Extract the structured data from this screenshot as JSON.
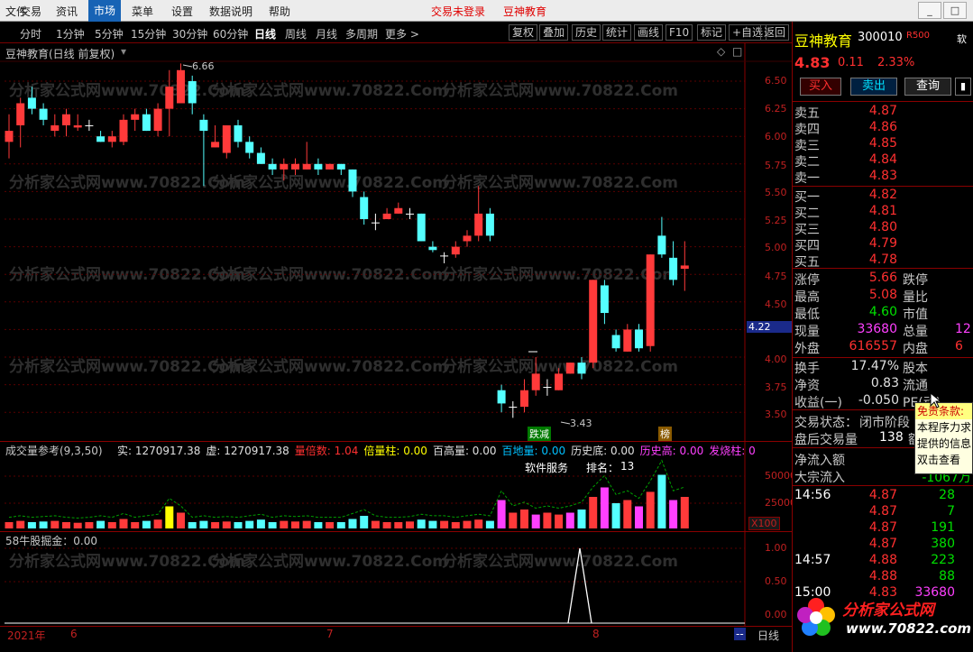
{
  "menu": {
    "items": [
      "文件",
      "交易",
      "资讯",
      "市场",
      "菜单",
      "设置",
      "数据说明",
      "帮助"
    ],
    "active": "市场",
    "login": "交易未登录",
    "brand": "豆神教育"
  },
  "toolbar": {
    "periods": [
      "分时",
      "1分钟",
      "5分钟",
      "15分钟",
      "30分钟",
      "60分钟",
      "日线",
      "周线",
      "月线",
      "多周期",
      "更多 >"
    ],
    "active": "日线",
    "buttons": [
      "复权",
      "叠加",
      "历史",
      "统计",
      "画线",
      "F10",
      "标记",
      "+自选",
      "返回"
    ]
  },
  "chart": {
    "title": "豆神教育(日线 前复权)",
    "price_labels": [
      "6.50",
      "6.25",
      "6.00",
      "5.75",
      "5.50",
      "5.25",
      "5.00",
      "4.75",
      "4.50",
      "4.22",
      "4.00",
      "3.75",
      "3.50"
    ],
    "current_price": "4.22",
    "high_marker": "6.66",
    "low_marker": "3.43",
    "tags": {
      "fall": "跌减",
      "bang": "榜"
    },
    "watermark": "分析家公式网www.70822.Com",
    "candles": [
      {
        "o": 5.95,
        "c": 6.05,
        "h": 6.2,
        "l": 5.8
      },
      {
        "o": 6.1,
        "c": 6.3,
        "h": 6.35,
        "l": 5.9
      },
      {
        "o": 6.35,
        "c": 6.25,
        "h": 6.45,
        "l": 6.2
      },
      {
        "o": 6.25,
        "c": 6.15,
        "h": 6.3,
        "l": 6.1
      },
      {
        "o": 6.05,
        "c": 6.1,
        "h": 6.2,
        "l": 6.0
      },
      {
        "o": 6.1,
        "c": 6.2,
        "h": 6.25,
        "l": 6.0
      },
      {
        "o": 6.08,
        "c": 6.1,
        "h": 6.2,
        "l": 6.05
      },
      {
        "o": 6.1,
        "c": 6.1,
        "h": 6.15,
        "l": 6.05
      },
      {
        "o": 6.0,
        "c": 5.95,
        "h": 6.05,
        "l": 5.95
      },
      {
        "o": 5.95,
        "c": 6.0,
        "h": 6.05,
        "l": 5.9
      },
      {
        "o": 5.95,
        "c": 6.15,
        "h": 6.2,
        "l": 5.92
      },
      {
        "o": 6.15,
        "c": 6.2,
        "h": 6.25,
        "l": 6.05
      },
      {
        "o": 6.2,
        "c": 6.05,
        "h": 6.25,
        "l": 6.05
      },
      {
        "o": 6.05,
        "c": 6.25,
        "h": 6.3,
        "l": 6.0
      },
      {
        "o": 6.25,
        "c": 6.45,
        "h": 6.6,
        "l": 6.0
      },
      {
        "o": 6.3,
        "c": 6.6,
        "h": 6.66,
        "l": 6.3
      },
      {
        "o": 6.5,
        "c": 6.3,
        "h": 6.55,
        "l": 6.2
      },
      {
        "o": 6.15,
        "c": 6.05,
        "h": 6.2,
        "l": 5.55
      },
      {
        "o": 5.9,
        "c": 5.95,
        "h": 6.1,
        "l": 5.9
      },
      {
        "o": 5.85,
        "c": 6.1,
        "h": 6.1,
        "l": 5.8
      },
      {
        "o": 6.1,
        "c": 5.95,
        "h": 6.15,
        "l": 5.9
      },
      {
        "o": 5.95,
        "c": 5.85,
        "h": 6.0,
        "l": 5.8
      },
      {
        "o": 5.85,
        "c": 5.75,
        "h": 5.9,
        "l": 5.75
      },
      {
        "o": 5.75,
        "c": 5.7,
        "h": 5.8,
        "l": 5.65
      },
      {
        "o": 5.7,
        "c": 5.75,
        "h": 5.8,
        "l": 5.6
      },
      {
        "o": 5.7,
        "c": 5.75,
        "h": 5.8,
        "l": 5.65
      },
      {
        "o": 5.7,
        "c": 5.75,
        "h": 5.95,
        "l": 5.7
      },
      {
        "o": 5.75,
        "c": 5.7,
        "h": 5.8,
        "l": 5.65
      },
      {
        "o": 5.7,
        "c": 5.75,
        "h": 5.75,
        "l": 5.7
      },
      {
        "o": 5.75,
        "c": 5.7,
        "h": 5.75,
        "l": 5.65
      },
      {
        "o": 5.7,
        "c": 5.5,
        "h": 5.7,
        "l": 5.45
      },
      {
        "o": 5.45,
        "c": 5.25,
        "h": 5.5,
        "l": 5.2
      },
      {
        "o": 5.22,
        "c": 5.22,
        "h": 5.3,
        "l": 5.15
      },
      {
        "o": 5.25,
        "c": 5.3,
        "h": 5.35,
        "l": 5.25
      },
      {
        "o": 5.3,
        "c": 5.35,
        "h": 5.4,
        "l": 5.3
      },
      {
        "o": 5.3,
        "c": 5.3,
        "h": 5.35,
        "l": 5.25
      },
      {
        "o": 5.3,
        "c": 5.05,
        "h": 5.3,
        "l": 5.05
      },
      {
        "o": 5.0,
        "c": 4.97,
        "h": 5.05,
        "l": 4.95
      },
      {
        "o": 4.92,
        "c": 4.92,
        "h": 4.95,
        "l": 4.85
      },
      {
        "o": 4.93,
        "c": 5.0,
        "h": 5.05,
        "l": 4.9
      },
      {
        "o": 5.05,
        "c": 5.1,
        "h": 5.15,
        "l": 5.0
      },
      {
        "o": 5.1,
        "c": 5.3,
        "h": 5.55,
        "l": 5.05
      },
      {
        "o": 5.3,
        "c": 5.1,
        "h": 5.35,
        "l": 5.05
      },
      {
        "o": 3.7,
        "c": 3.58,
        "h": 3.75,
        "l": 3.5
      },
      {
        "o": 3.55,
        "c": 3.55,
        "h": 3.6,
        "l": 3.45
      },
      {
        "o": 3.55,
        "c": 3.7,
        "h": 3.8,
        "l": 3.5
      },
      {
        "o": 3.7,
        "c": 3.85,
        "h": 4.0,
        "l": 3.65
      },
      {
        "o": 3.73,
        "c": 3.73,
        "h": 3.8,
        "l": 3.65
      },
      {
        "o": 3.7,
        "c": 3.85,
        "h": 3.9,
        "l": 3.7
      },
      {
        "o": 3.85,
        "c": 3.95,
        "h": 3.95,
        "l": 3.85
      },
      {
        "o": 3.95,
        "c": 3.85,
        "h": 4.0,
        "l": 3.8
      },
      {
        "o": 3.95,
        "c": 4.7,
        "h": 4.7,
        "l": 3.9
      },
      {
        "o": 4.65,
        "c": 4.4,
        "h": 4.7,
        "l": 4.3
      },
      {
        "o": 4.2,
        "c": 4.08,
        "h": 4.25,
        "l": 4.05
      },
      {
        "o": 4.05,
        "c": 4.25,
        "h": 4.3,
        "l": 4.05
      },
      {
        "o": 4.25,
        "c": 4.08,
        "h": 4.3,
        "l": 4.05
      },
      {
        "o": 4.1,
        "c": 4.93,
        "h": 4.93,
        "l": 4.05
      },
      {
        "o": 5.1,
        "c": 4.93,
        "h": 5.27,
        "l": 4.9
      },
      {
        "o": 4.9,
        "c": 4.7,
        "h": 5.05,
        "l": 4.65
      },
      {
        "o": 4.8,
        "c": 4.83,
        "h": 5.05,
        "l": 4.6
      }
    ]
  },
  "volume": {
    "title": "成交量参考(9,3,50)",
    "items": [
      {
        "k": "实:",
        "v": "1270917.38",
        "c": "#e0e0e0"
      },
      {
        "k": "虚:",
        "v": "1270917.38",
        "c": "#e0e0e0"
      },
      {
        "k": "量倍数:",
        "v": "1.04",
        "c": "#ff3030"
      },
      {
        "k": "倍量柱:",
        "v": "0.00",
        "c": "#ffff00"
      },
      {
        "k": "百高量:",
        "v": "0.00",
        "c": "#e0e0e0"
      },
      {
        "k": "百地量:",
        "v": "0.00",
        "c": "#00c0ff"
      },
      {
        "k": "历史底:",
        "v": "0.00",
        "c": "#e0e0e0"
      },
      {
        "k": "历史高:",
        "v": "0.00",
        "c": "#ff40ff"
      },
      {
        "k": "发烧柱:",
        "v": "0",
        "c": "#ff40ff"
      }
    ],
    "service": "软件服务",
    "rank_label": "排名：",
    "rank": "13",
    "labels": [
      "50000",
      "25000"
    ],
    "unit": "X100",
    "bars": [
      0.1,
      0.12,
      0.1,
      0.11,
      0.12,
      0.1,
      0.09,
      0.1,
      0.12,
      0.1,
      0.15,
      0.1,
      0.12,
      0.14,
      0.35,
      0.25,
      0.1,
      0.12,
      0.1,
      0.11,
      0.1,
      0.12,
      0.14,
      0.1,
      0.12,
      0.11,
      0.12,
      0.1,
      0.1,
      0.1,
      0.15,
      0.2,
      0.12,
      0.1,
      0.1,
      0.11,
      0.14,
      0.12,
      0.12,
      0.1,
      0.12,
      0.14,
      0.12,
      0.45,
      0.25,
      0.3,
      0.22,
      0.25,
      0.22,
      0.25,
      0.3,
      0.5,
      0.65,
      0.4,
      0.45,
      0.35,
      0.58,
      0.85,
      0.45,
      0.5
    ]
  },
  "indicator": {
    "title": "58牛股掘金：0.00",
    "labels": [
      "1.00",
      "0.50",
      "0.00"
    ]
  },
  "axis": {
    "labels": [
      "2021年",
      "6",
      "7",
      "8"
    ],
    "period": "日线"
  },
  "quote": {
    "name": "豆神教育",
    "code": "300010",
    "tag": "R500",
    "soft": "软",
    "price": "4.83",
    "change": "0.11",
    "pct": "2.33%",
    "buttons": [
      "买入",
      "卖出",
      "查询"
    ],
    "sells": [
      {
        "l": "卖五",
        "p": "4.87"
      },
      {
        "l": "卖四",
        "p": "4.86"
      },
      {
        "l": "卖三",
        "p": "4.85"
      },
      {
        "l": "卖二",
        "p": "4.84"
      },
      {
        "l": "卖一",
        "p": "4.83"
      }
    ],
    "buys": [
      {
        "l": "买一",
        "p": "4.82"
      },
      {
        "l": "买二",
        "p": "4.81"
      },
      {
        "l": "买三",
        "p": "4.80"
      },
      {
        "l": "买四",
        "p": "4.79"
      },
      {
        "l": "买五",
        "p": "4.78"
      }
    ],
    "stats": [
      {
        "l": "涨停",
        "v": "5.66",
        "c": "red",
        "l2": "跌停"
      },
      {
        "l": "最高",
        "v": "5.08",
        "c": "red",
        "l2": "量比"
      },
      {
        "l": "最低",
        "v": "4.60",
        "c": "green",
        "l2": "市值"
      },
      {
        "l": "现量",
        "v": "33680",
        "c": "mag",
        "l2": "总量",
        "v2": "12"
      },
      {
        "l": "外盘",
        "v": "616557",
        "c": "red",
        "l2": "内盘",
        "v2": "6"
      }
    ],
    "stats2": [
      {
        "l": "换手",
        "v": "17.47%",
        "l2": "股本"
      },
      {
        "l": "净资",
        "v": "0.83",
        "l2": "流通"
      },
      {
        "l": "收益(一)",
        "v": "-0.050",
        "l2": "PE(动)"
      }
    ],
    "status_label": "交易状态：",
    "status": "闭市阶段",
    "after_label": "盘后交易量",
    "after_val": "138",
    "after_unit": "额",
    "net_inflow": "净流入额",
    "block_inflow": "大宗流入",
    "block_val": "-1067万",
    "ticks": [
      {
        "t": "14:56",
        "p": "4.87",
        "v": "28",
        "c": "green"
      },
      {
        "t": "",
        "p": "4.87",
        "v": "7",
        "c": "green"
      },
      {
        "t": "",
        "p": "4.87",
        "v": "191",
        "c": "green"
      },
      {
        "t": "",
        "p": "4.87",
        "v": "380",
        "c": "green"
      },
      {
        "t": "14:57",
        "p": "4.88",
        "v": "223",
        "c": "green"
      },
      {
        "t": "",
        "p": "4.88",
        "v": "88",
        "c": "green"
      },
      {
        "t": "15:00",
        "p": "4.83",
        "v": "33680",
        "c": "mag"
      }
    ]
  },
  "tooltip": {
    "lines": [
      "免责条款:",
      "本程序力求",
      "提供的信息",
      "双击查看"
    ]
  },
  "logo": {
    "name": "分析家公式网",
    "url": "www.70822.com"
  }
}
